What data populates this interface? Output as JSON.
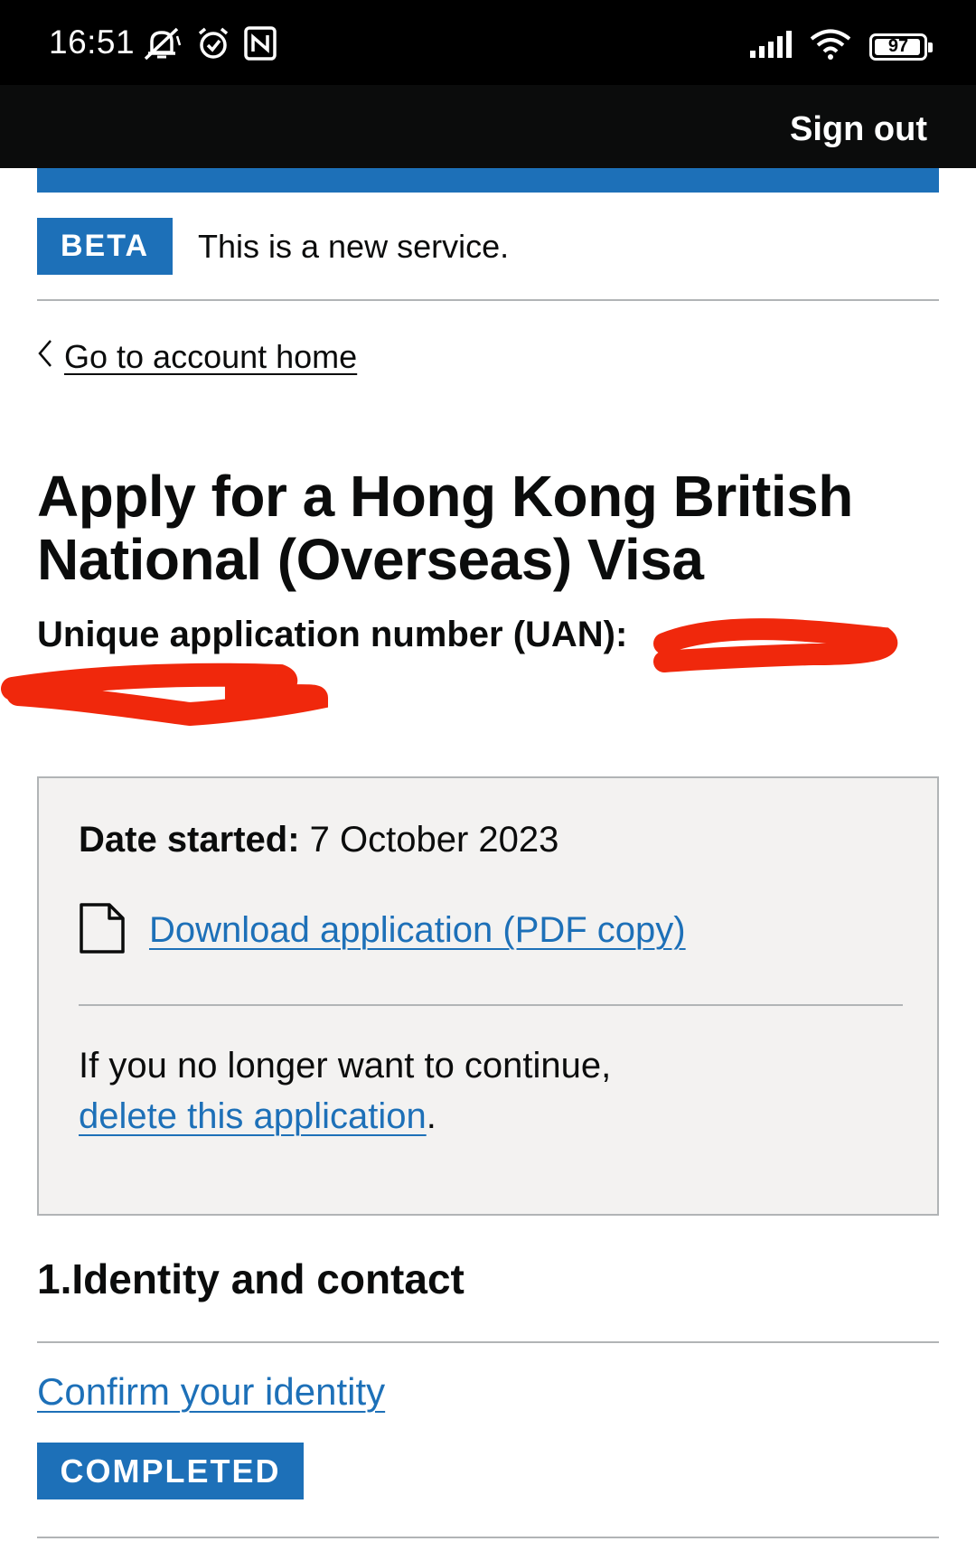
{
  "status_bar": {
    "time": "16:51",
    "battery": "97",
    "battery_level": 0.97,
    "icons": [
      "notifications-muted-icon",
      "alarm-icon",
      "nfc-icon",
      "signal-icon",
      "wifi-icon",
      "battery-icon"
    ]
  },
  "header": {
    "sign_out": "Sign out",
    "background": "#0b0c0c",
    "accent": "#1d70b8"
  },
  "phase_banner": {
    "tag": "BETA",
    "text": "This is a new service."
  },
  "navigation": {
    "back_link": "Go to account home"
  },
  "page": {
    "title": "Apply for a Hong Kong British National (Overseas) Visa",
    "uan_label": "Unique application number (UAN):"
  },
  "summary_box": {
    "date_label": "Date started:",
    "date_value": "7 October 2023",
    "download_link": "Download application (PDF copy)",
    "continue_text": "If you no longer want to continue,",
    "delete_link": "delete this application",
    "delete_suffix": "."
  },
  "sections": [
    {
      "heading": "1.Identity and contact",
      "tasks": [
        {
          "label": "Confirm your identity",
          "status": "COMPLETED"
        }
      ]
    }
  ],
  "colors": {
    "link": "#1d70b8",
    "tag_background": "#1d70b8",
    "redaction": "#f0280c",
    "box_background": "#f3f2f1",
    "border": "#b1b4b6"
  }
}
